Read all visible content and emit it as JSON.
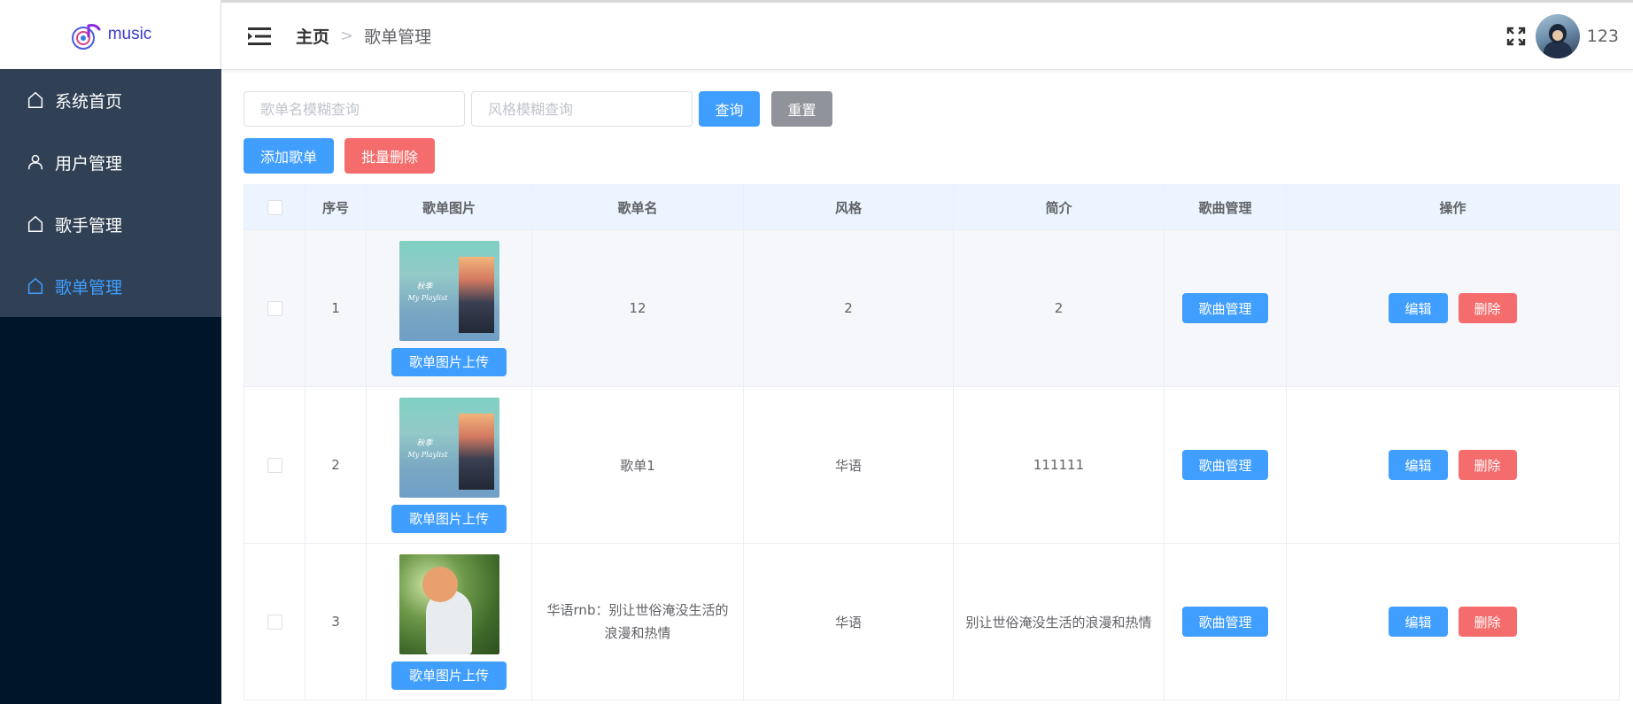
{
  "logo": {
    "text": "music"
  },
  "sidebar": {
    "items": [
      {
        "label": "系统首页",
        "icon": "home-icon",
        "active": false
      },
      {
        "label": "用户管理",
        "icon": "user-icon",
        "active": false
      },
      {
        "label": "歌手管理",
        "icon": "home-icon",
        "active": false
      },
      {
        "label": "歌单管理",
        "icon": "home-icon",
        "active": true
      }
    ]
  },
  "header": {
    "breadcrumb_home": "主页",
    "breadcrumb_separator": ">",
    "breadcrumb_current": "歌单管理",
    "username": "123"
  },
  "search": {
    "name_placeholder": "歌单名模糊查询",
    "style_placeholder": "风格模糊查询",
    "query_label": "查询",
    "reset_label": "重置"
  },
  "actions": {
    "add_label": "添加歌单",
    "batch_delete_label": "批量删除"
  },
  "table": {
    "columns": [
      "",
      "序号",
      "歌单图片",
      "歌单名",
      "风格",
      "简介",
      "歌曲管理",
      "操作"
    ],
    "upload_label": "歌单图片上传",
    "song_manage_label": "歌曲管理",
    "edit_label": "编辑",
    "delete_label": "删除",
    "rows": [
      {
        "index": "1",
        "name": "12",
        "style": "2",
        "intro": "2",
        "cover": "my-playlist-cover",
        "cover_text1": "秋季",
        "cover_text2": "My Playlist"
      },
      {
        "index": "2",
        "name": "歌单1",
        "style": "华语",
        "intro": "111111",
        "cover": "my-playlist-cover",
        "cover_text1": "秋季",
        "cover_text2": "My Playlist"
      },
      {
        "index": "3",
        "name": "华语rnb：别让世俗淹没生活的浪漫和热情",
        "style": "华语",
        "intro": "别让世俗淹没生活的浪漫和热情",
        "cover": "girl-in-garden-cover"
      }
    ]
  },
  "colors": {
    "sidebar_bg": "#001529",
    "menu_bg": "#304156",
    "primary": "#409eff",
    "danger": "#f56c6c",
    "info": "#909399",
    "header_row_bg": "#ecf5ff"
  }
}
